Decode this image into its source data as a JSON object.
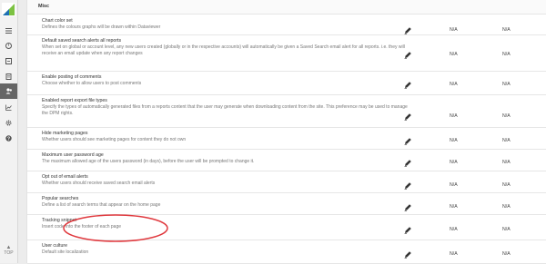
{
  "sidebar": {
    "logo": "logo-icon",
    "items": [
      {
        "icon": "menu-icon"
      },
      {
        "icon": "dashboard-icon"
      },
      {
        "icon": "history-icon"
      },
      {
        "icon": "document-icon"
      },
      {
        "icon": "users-icon",
        "active": true
      },
      {
        "icon": "chart-icon"
      },
      {
        "icon": "gear-icon"
      },
      {
        "icon": "help-icon"
      }
    ],
    "top_label": "TOP"
  },
  "section": {
    "title": "Misc"
  },
  "rows": [
    {
      "name": "Chart color set",
      "description": "Defines the colours graphs will be drawn within Dataviewer",
      "value1": "N/A",
      "value2": "N/A"
    },
    {
      "name": "Default saved search alerts all reports",
      "description": "When set on global or account level, any new users created (globally or in the respective accounts) will automatically be given a Saved Search email alert for all reports. i.e. they will receive an email update when any report changes",
      "value1": "N/A",
      "value2": "N/A"
    },
    {
      "name": "Enable posting of comments",
      "description": "Choose whether to allow users to post comments",
      "value1": "N/A",
      "value2": "N/A"
    },
    {
      "name": "Enabled report export file types",
      "description": "Specify the types of automatically generated files from a reports content that the user may generate when downloading content from the site. This preference may be used to manage the DPM rights.",
      "value1": "N/A",
      "value2": "N/A"
    },
    {
      "name": "Hide marketing pages",
      "description": "Whether users should see marketing pages for content they do not own",
      "value1": "N/A",
      "value2": "N/A"
    },
    {
      "name": "Maximum user password age",
      "description": "The maximum allowed age of the users password (in days), before the user will be prompted to change it.",
      "value1": "N/A",
      "value2": "N/A"
    },
    {
      "name": "Opt out of email alerts",
      "description": "Whether users should receive saved search email alerts",
      "value1": "N/A",
      "value2": "N/A"
    },
    {
      "name": "Popular searches",
      "description": "Define a list of search terms that appear on the home page",
      "value1": "N/A",
      "value2": "N/A"
    },
    {
      "name": "Tracking snippet",
      "description": "Insert code into the footer of each page",
      "value1": "N/A",
      "value2": "N/A"
    },
    {
      "name": "User culture",
      "description": "Default site localization",
      "value1": "N/A",
      "value2": "N/A"
    }
  ],
  "colors": {
    "highlight": "#e0393e",
    "brand_green": "#7cc242",
    "brand_blue": "#1d6fb5"
  }
}
